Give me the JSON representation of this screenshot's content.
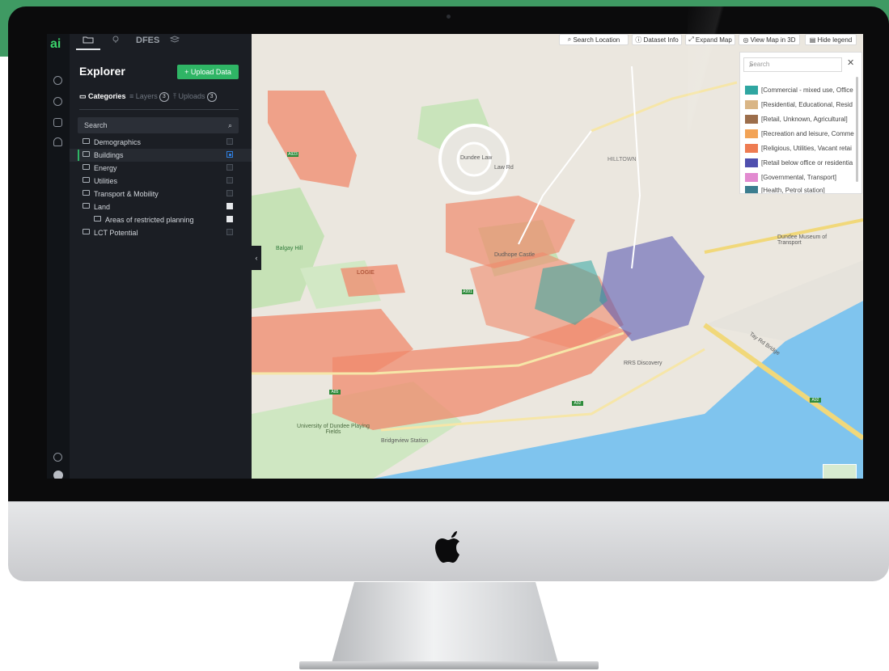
{
  "app": {
    "rail": {
      "logo": "ai"
    },
    "tabs": {
      "tab3": "DFES"
    },
    "explorer": {
      "title": "Explorer",
      "upload_button": "+ Upload Data",
      "subtabs": [
        {
          "label": "Categories",
          "badge": ""
        },
        {
          "label": "Layers",
          "badge": "3"
        },
        {
          "label": "Uploads",
          "badge": "3"
        }
      ],
      "search_placeholder": "Search",
      "categories": [
        {
          "label": "Demographics",
          "checked": "none"
        },
        {
          "label": "Buildings",
          "checked": "partial"
        },
        {
          "label": "Energy",
          "checked": "none"
        },
        {
          "label": "Utilities",
          "checked": "none"
        },
        {
          "label": "Transport & Mobility",
          "checked": "none"
        },
        {
          "label": "Land",
          "checked": "checked"
        },
        {
          "label": "Areas of restricted planning",
          "checked": "checked"
        },
        {
          "label": "LCT Potential",
          "checked": "none"
        }
      ]
    },
    "map": {
      "toolbar": {
        "search_location": "Search Location",
        "dataset_info": "Dataset Info",
        "expand_map": "Expand Map",
        "view_3d": "View Map in 3D",
        "hide_legend": "Hide legend"
      },
      "legend": {
        "search_placeholder": "Search",
        "items": [
          {
            "label": "[Commercial - mixed use, Office",
            "color": "#2fa6a1"
          },
          {
            "label": "[Residential, Educational, Resid",
            "color": "#d9b585"
          },
          {
            "label": "[Retail, Unknown, Agricultural]",
            "color": "#9c6e4b"
          },
          {
            "label": "[Recreation and leisure, Comme",
            "color": "#f2a356"
          },
          {
            "label": "[Religious, Utilities, Vacant retai",
            "color": "#ee7c52"
          },
          {
            "label": "[Retail below office or residentia",
            "color": "#4f4fae"
          },
          {
            "label": "[Governmental, Transport]",
            "color": "#e28ad0"
          },
          {
            "label": "[Health, Petrol station]",
            "color": "#3b7d8f"
          }
        ]
      },
      "labels": {
        "dundee_law": "Dundee Law",
        "law_rd": "Law Rd",
        "balgay_hill": "Balgay Hill",
        "logie": "LOGIE",
        "university": "University of Dundee Playing Fields",
        "bridgeview": "Bridgeview Station",
        "rrs": "RRS Discovery",
        "tay_bridge": "Tay Rd Bridge",
        "dudhope": "Dudhope Castle",
        "dundee_museum": "Dundee Museum of Transport",
        "hilltown": "HILLTOWN"
      },
      "roads": {
        "a92": "A92",
        "a991": "A991",
        "a85": "A85",
        "a923": "A923"
      }
    }
  }
}
